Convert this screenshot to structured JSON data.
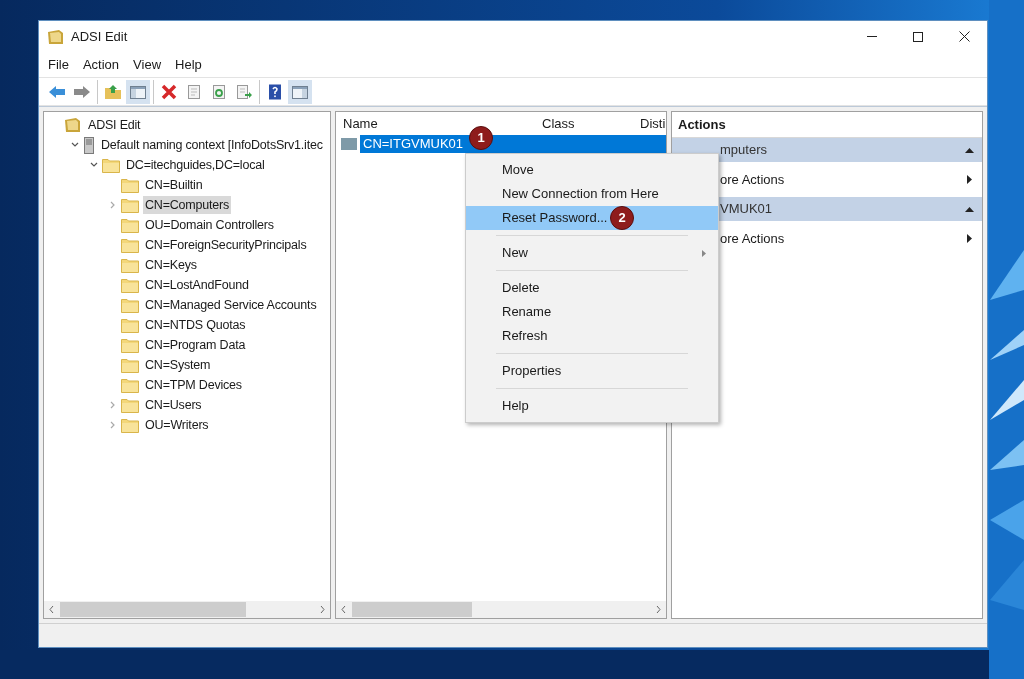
{
  "window": {
    "title": "ADSI Edit"
  },
  "menu_bar": [
    "File",
    "Action",
    "View",
    "Help"
  ],
  "toolbar": {
    "groups": [
      {
        "buttons": [
          {
            "kind": "back",
            "pressed": false
          },
          {
            "kind": "forward",
            "pressed": false
          }
        ]
      },
      {
        "buttons": [
          {
            "kind": "up",
            "pressed": false
          },
          {
            "kind": "tree",
            "pressed": true
          }
        ]
      },
      {
        "buttons": [
          {
            "kind": "delete",
            "pressed": false
          },
          {
            "kind": "properties",
            "pressed": false
          },
          {
            "kind": "refresh",
            "pressed": false
          },
          {
            "kind": "export",
            "pressed": false
          }
        ]
      },
      {
        "buttons": [
          {
            "kind": "help",
            "pressed": false
          },
          {
            "kind": "action_pane",
            "pressed": true
          }
        ]
      }
    ]
  },
  "tree": [
    {
      "label": "ADSI Edit",
      "kind": "root",
      "selected": false,
      "children": [
        {
          "label": "Default naming context [InfoDotsSrv1.itec",
          "kind": "server",
          "expanded": true,
          "selected": false,
          "children": [
            {
              "label": "DC=itechguides,DC=local",
              "kind": "folder",
              "expanded": true,
              "selected": false,
              "children": [
                {
                  "label": "CN=Builtin",
                  "kind": "folder",
                  "selected": false
                },
                {
                  "label": "CN=Computers",
                  "kind": "folder",
                  "expanded": false,
                  "selected": true
                },
                {
                  "label": "OU=Domain Controllers",
                  "kind": "folder",
                  "selected": false
                },
                {
                  "label": "CN=ForeignSecurityPrincipals",
                  "kind": "folder",
                  "selected": false
                },
                {
                  "label": "CN=Keys",
                  "kind": "folder",
                  "selected": false
                },
                {
                  "label": "CN=LostAndFound",
                  "kind": "folder",
                  "selected": false
                },
                {
                  "label": "CN=Managed Service Accounts",
                  "kind": "folder",
                  "selected": false
                },
                {
                  "label": "CN=NTDS Quotas",
                  "kind": "folder",
                  "selected": false
                },
                {
                  "label": "CN=Program Data",
                  "kind": "folder",
                  "selected": false
                },
                {
                  "label": "CN=System",
                  "kind": "folder",
                  "selected": false
                },
                {
                  "label": "CN=TPM Devices",
                  "kind": "folder",
                  "selected": false
                },
                {
                  "label": "CN=Users",
                  "kind": "folder",
                  "expanded": false,
                  "selected": false
                },
                {
                  "label": "OU=Writers",
                  "kind": "folder",
                  "expanded": false,
                  "selected": false
                }
              ]
            }
          ]
        }
      ]
    }
  ],
  "list": {
    "columns": [
      "Name",
      "Class",
      "Disti"
    ],
    "rows": [
      {
        "name": "CN=ITGVMUK01",
        "selected": true,
        "callout": "1"
      }
    ]
  },
  "context_menu": {
    "items": [
      {
        "kind": "item",
        "label": "Move",
        "selected": false
      },
      {
        "kind": "item",
        "label": "New Connection from Here",
        "selected": false
      },
      {
        "kind": "item",
        "label": "Reset Password...",
        "selected": true,
        "callout": "2"
      },
      {
        "kind": "separator"
      },
      {
        "kind": "submenu",
        "label": "New",
        "selected": false
      },
      {
        "kind": "separator"
      },
      {
        "kind": "item",
        "label": "Delete",
        "selected": false
      },
      {
        "kind": "item",
        "label": "Rename",
        "selected": false
      },
      {
        "kind": "item",
        "label": "Refresh",
        "selected": false
      },
      {
        "kind": "separator"
      },
      {
        "kind": "item",
        "label": "Properties",
        "selected": false
      },
      {
        "kind": "separator"
      },
      {
        "kind": "item",
        "label": "Help",
        "selected": false
      }
    ]
  },
  "actions": {
    "title": "Actions",
    "sections": [
      {
        "header": "mputers",
        "expanded": true,
        "items": [
          "ore Actions"
        ]
      },
      {
        "header": "VMUK01",
        "expanded": true,
        "items": [
          "ore Actions"
        ]
      }
    ]
  }
}
